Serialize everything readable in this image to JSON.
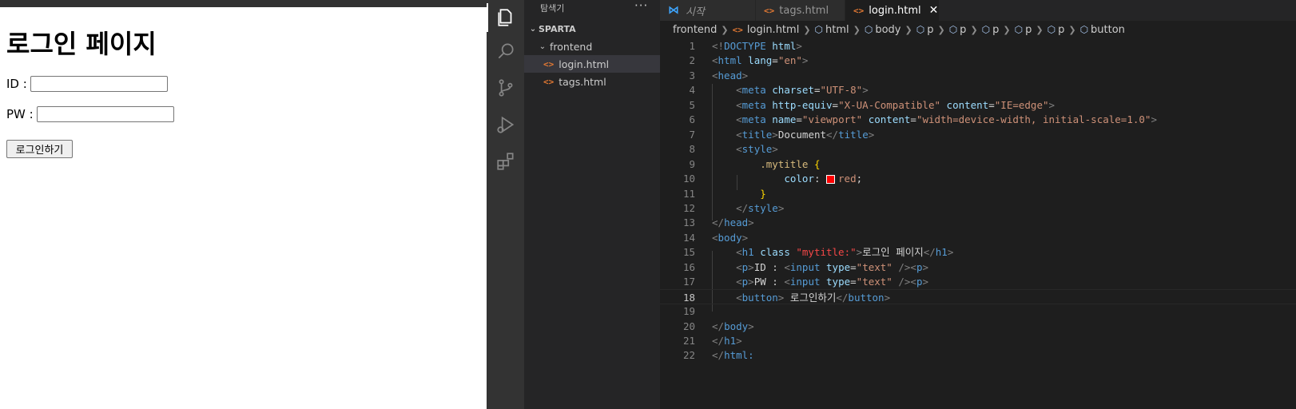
{
  "browser": {
    "heading": "로그인 페이지",
    "id_label": "ID :",
    "pw_label": "PW :",
    "login_button": "로그인하기"
  },
  "explorer": {
    "header": "탐색기",
    "more": "···",
    "workspace": "SPARTA",
    "folder": "frontend",
    "files": [
      "login.html",
      "tags.html"
    ]
  },
  "tabs": [
    {
      "label": "시작"
    },
    {
      "label": "tags.html"
    },
    {
      "label": "login.html",
      "close": "✕"
    }
  ],
  "breadcrumb": [
    "frontend",
    "login.html",
    "html",
    "body",
    "p",
    "p",
    "p",
    "p",
    "p",
    "button"
  ],
  "editor": {
    "current_line": 18,
    "line_numbers": [
      "1",
      "2",
      "3",
      "4",
      "5",
      "6",
      "7",
      "8",
      "9",
      "10",
      "11",
      "12",
      "13",
      "14",
      "15",
      "16",
      "17",
      "18",
      "19",
      "20",
      "21",
      "22"
    ],
    "lines": [
      [
        [
          "punc",
          "<!"
        ],
        [
          "tag",
          "DOCTYPE "
        ],
        [
          "attr",
          "html"
        ],
        [
          "punc",
          ">"
        ]
      ],
      [
        [
          "punc",
          "<"
        ],
        [
          "tag",
          "html "
        ],
        [
          "attr",
          "lang"
        ],
        [
          "text",
          "="
        ],
        [
          "str",
          "\"en\""
        ],
        [
          "punc",
          ">"
        ]
      ],
      [
        [
          "punc",
          "<"
        ],
        [
          "tag",
          "head"
        ],
        [
          "punc",
          ">"
        ]
      ],
      [
        [
          "text",
          "    "
        ],
        [
          "punc",
          "<"
        ],
        [
          "tag",
          "meta "
        ],
        [
          "attr",
          "charset"
        ],
        [
          "text",
          "="
        ],
        [
          "str",
          "\"UTF-8\""
        ],
        [
          "punc",
          ">"
        ]
      ],
      [
        [
          "text",
          "    "
        ],
        [
          "punc",
          "<"
        ],
        [
          "tag",
          "meta "
        ],
        [
          "attr",
          "http-equiv"
        ],
        [
          "text",
          "="
        ],
        [
          "str",
          "\"X-UA-Compatible\" "
        ],
        [
          "attr",
          "content"
        ],
        [
          "text",
          "="
        ],
        [
          "str",
          "\"IE=edge\""
        ],
        [
          "punc",
          ">"
        ]
      ],
      [
        [
          "text",
          "    "
        ],
        [
          "punc",
          "<"
        ],
        [
          "tag",
          "meta "
        ],
        [
          "attr",
          "name"
        ],
        [
          "text",
          "="
        ],
        [
          "str",
          "\"viewport\" "
        ],
        [
          "attr",
          "content"
        ],
        [
          "text",
          "="
        ],
        [
          "str",
          "\"width=device-width, initial-scale=1.0\""
        ],
        [
          "punc",
          ">"
        ]
      ],
      [
        [
          "text",
          "    "
        ],
        [
          "punc",
          "<"
        ],
        [
          "tag",
          "title"
        ],
        [
          "punc",
          ">"
        ],
        [
          "text",
          "Document"
        ],
        [
          "punc",
          "</"
        ],
        [
          "tag",
          "title"
        ],
        [
          "punc",
          ">"
        ]
      ],
      [
        [
          "text",
          "    "
        ],
        [
          "punc",
          "<"
        ],
        [
          "tag",
          "style"
        ],
        [
          "punc",
          ">"
        ]
      ],
      [
        [
          "text",
          "        "
        ],
        [
          "sel",
          ".mytitle "
        ],
        [
          "brace",
          "{"
        ]
      ],
      [
        [
          "text",
          "            "
        ],
        [
          "attr",
          "color"
        ],
        [
          "text",
          ": "
        ],
        [
          "swatch",
          ""
        ],
        [
          "str",
          "red"
        ],
        [
          "text",
          ";"
        ]
      ],
      [
        [
          "text",
          "        "
        ],
        [
          "brace",
          "}"
        ]
      ],
      [
        [
          "text",
          "    "
        ],
        [
          "punc",
          "</"
        ],
        [
          "tag",
          "style"
        ],
        [
          "punc",
          ">"
        ]
      ],
      [
        [
          "punc",
          "</"
        ],
        [
          "tag",
          "head"
        ],
        [
          "punc",
          ">"
        ]
      ],
      [
        [
          "punc",
          "<"
        ],
        [
          "tag",
          "body"
        ],
        [
          "punc",
          ">"
        ]
      ],
      [
        [
          "text",
          "    "
        ],
        [
          "punc",
          "<"
        ],
        [
          "tag",
          "h1 "
        ],
        [
          "attr",
          "class "
        ],
        [
          "err",
          "\"mytitle:\""
        ],
        [
          "punc",
          ">"
        ],
        [
          "text",
          "로그인 페이지"
        ],
        [
          "punc",
          "</"
        ],
        [
          "tag",
          "h1"
        ],
        [
          "punc",
          ">"
        ]
      ],
      [
        [
          "text",
          "    "
        ],
        [
          "punc",
          "<"
        ],
        [
          "tag",
          "p"
        ],
        [
          "punc",
          ">"
        ],
        [
          "text",
          "ID : "
        ],
        [
          "punc",
          "<"
        ],
        [
          "tag",
          "input "
        ],
        [
          "attr",
          "type"
        ],
        [
          "text",
          "="
        ],
        [
          "str",
          "\"text\" "
        ],
        [
          "punc",
          "/><"
        ],
        [
          "tag",
          "p"
        ],
        [
          "punc",
          ">"
        ]
      ],
      [
        [
          "text",
          "    "
        ],
        [
          "punc",
          "<"
        ],
        [
          "tag",
          "p"
        ],
        [
          "punc",
          ">"
        ],
        [
          "text",
          "PW : "
        ],
        [
          "punc",
          "<"
        ],
        [
          "tag",
          "input "
        ],
        [
          "attr",
          "type"
        ],
        [
          "text",
          "="
        ],
        [
          "str",
          "\"text\" "
        ],
        [
          "punc",
          "/><"
        ],
        [
          "tag",
          "p"
        ],
        [
          "punc",
          ">"
        ]
      ],
      [
        [
          "text",
          "    "
        ],
        [
          "punc",
          "<"
        ],
        [
          "tag",
          "button"
        ],
        [
          "punc",
          ">"
        ],
        [
          "text",
          " 로그인하기"
        ],
        [
          "punc",
          "</"
        ],
        [
          "tag",
          "button"
        ],
        [
          "punc",
          ">"
        ]
      ],
      [],
      [
        [
          "punc",
          "</"
        ],
        [
          "tag",
          "body"
        ],
        [
          "punc",
          ">"
        ]
      ],
      [
        [
          "punc",
          "</"
        ],
        [
          "tag",
          "h1"
        ],
        [
          "punc",
          ">"
        ]
      ],
      [
        [
          "punc",
          "</"
        ],
        [
          "tag",
          "html:"
        ]
      ]
    ]
  },
  "colors": {
    "editor_bg": "#1e1e1e",
    "activity_bar": "#333333",
    "sidebar": "#252526",
    "tag": "#569cd6",
    "attr": "#9cdcfe",
    "string": "#ce9178",
    "html_icon": "#e37933"
  },
  "activity_icons": [
    "explorer-icon",
    "search-icon",
    "source-control-icon",
    "run-debug-icon",
    "extensions-icon"
  ]
}
